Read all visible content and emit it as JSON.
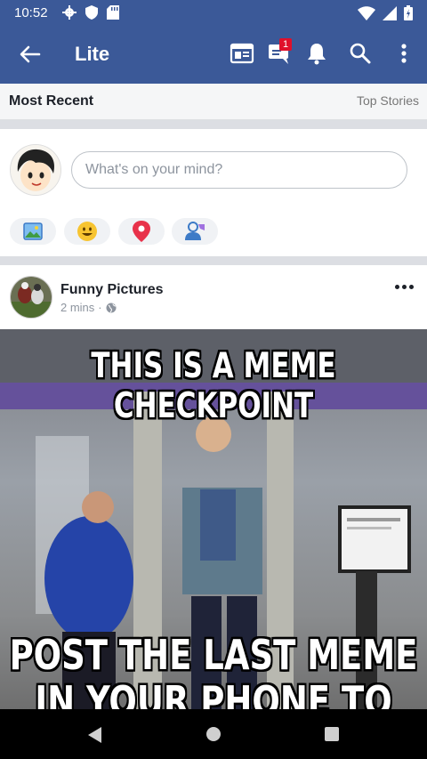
{
  "status_bar": {
    "time": "10:52",
    "icons": [
      "gear-icon",
      "shield-icon",
      "sd-card-icon",
      "wifi-icon",
      "signal-icon",
      "battery-icon"
    ]
  },
  "top_bar": {
    "title": "Lite",
    "messages_badge": "1",
    "icons": [
      "back-arrow-icon",
      "news-feed-icon",
      "messages-icon",
      "notifications-bell-icon",
      "search-icon",
      "more-vertical-icon"
    ]
  },
  "feed_tabs": {
    "left": "Most Recent",
    "right": "Top Stories"
  },
  "composer": {
    "placeholder": "What's on your mind?",
    "actions": [
      "photo-icon",
      "emoji-icon",
      "location-pin-icon",
      "tag-friend-icon"
    ]
  },
  "post": {
    "author": "Funny Pictures",
    "time": "2 mins",
    "separator": "·",
    "privacy_icon": "globe-icon",
    "image": {
      "caption_top": "THIS IS A MEME CHECKPOINT",
      "caption_bottom_1": "POST THE LAST MEME",
      "caption_bottom_2": "IN YOUR PHONE TO PASS"
    }
  },
  "colors": {
    "brand_blue": "#3b5998",
    "badge_red": "#e0102b",
    "separator_gray": "#dcdee3"
  },
  "nav_bar": {
    "buttons": [
      "back-triangle-icon",
      "home-circle-icon",
      "recents-square-icon"
    ]
  }
}
